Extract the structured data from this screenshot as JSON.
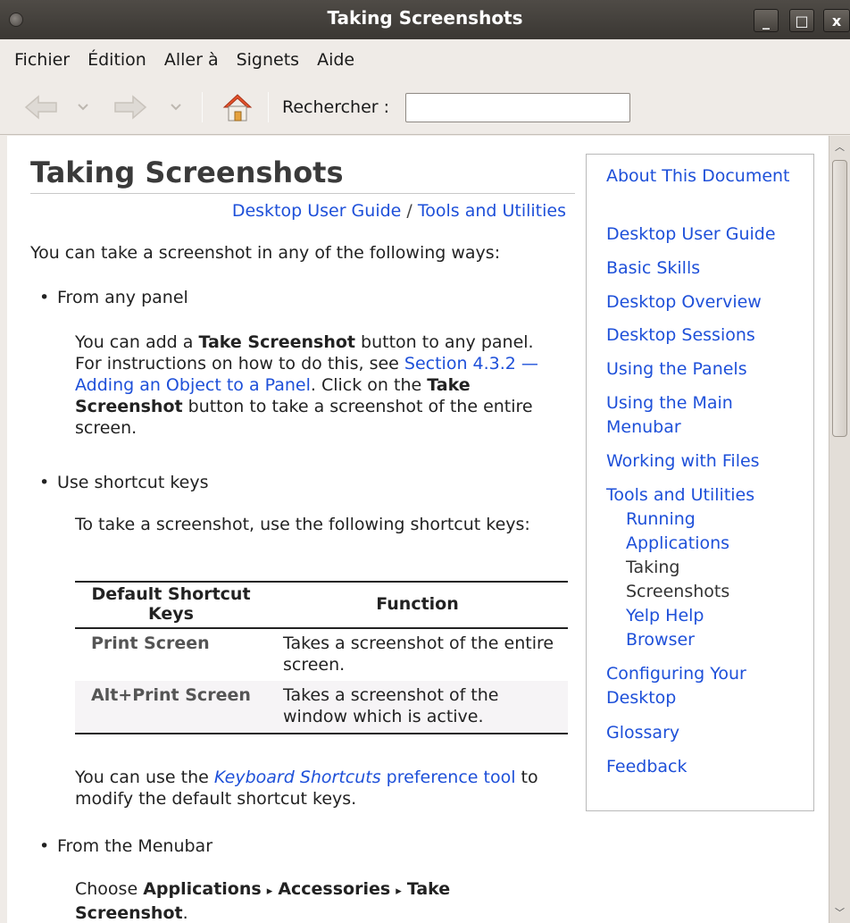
{
  "window": {
    "title": "Taking Screenshots"
  },
  "menu": {
    "file": "Fichier",
    "edit": "Édition",
    "go": "Aller à",
    "bookmarks": "Signets",
    "help": "Aide"
  },
  "toolbar": {
    "search_label": "Rechercher :",
    "search_value": "",
    "icons": [
      "back-arrow-icon",
      "chevron-down-icon",
      "forward-arrow-icon",
      "chevron-down-icon",
      "home-icon"
    ]
  },
  "page": {
    "title": "Taking Screenshots",
    "breadcrumb": {
      "guide": "Desktop User Guide",
      "separator": "/",
      "section": "Tools and Utilities"
    },
    "intro": "You can take a screenshot in any of the following ways:",
    "panel": {
      "bullet": "From any panel",
      "p1": "You can add a ",
      "p1_bold": "Take Screenshot",
      "p1_after": " button to any panel. For instructions on how to do this, see ",
      "p1_link": "Section 4.3.2 — Adding an Object to a Panel",
      "p1_end": ". Click on the ",
      "p2_bold": "Take Screenshot",
      "p2_after": " button to take a screenshot of the entire screen."
    },
    "shortcut": {
      "bullet": "Use shortcut keys",
      "intro": "To take a screenshot, use the following shortcut keys:",
      "table": {
        "headers": [
          "Default Shortcut Keys",
          "Function"
        ],
        "rows": [
          {
            "key": "Print Screen",
            "function": "Takes a screenshot of the entire screen."
          },
          {
            "key": "Alt+Print Screen",
            "function": "Takes a screenshot of the window which is active."
          }
        ]
      },
      "after_start": "You can use the ",
      "after_link_italic": "Keyboard Shortcuts",
      "after_link_rest": " preference tool",
      "after_end": " to modify the default shortcut keys."
    },
    "menubar": {
      "bullet": "From the Menubar",
      "choose": "Choose ",
      "path1": "Applications",
      "path2": "Accessories",
      "path3": "Take Screenshot",
      "arrow": "▸",
      "end": "."
    }
  },
  "toc": {
    "items": [
      "About This Document",
      "Desktop User Guide",
      "Basic Skills",
      "Desktop Overview",
      "Desktop Sessions",
      "Using the Panels",
      "Using the Main Menubar",
      "Working with Files",
      "Tools and Utilities",
      "Configuring Your Desktop",
      "Glossary",
      "Feedback"
    ],
    "subitems": [
      "Running Applications",
      "Taking Screenshots",
      "Yelp Help Browser"
    ]
  },
  "colors": {
    "link": "#1e50d9",
    "titlebar": "#3f3c38",
    "chrome": "#efebe7"
  }
}
